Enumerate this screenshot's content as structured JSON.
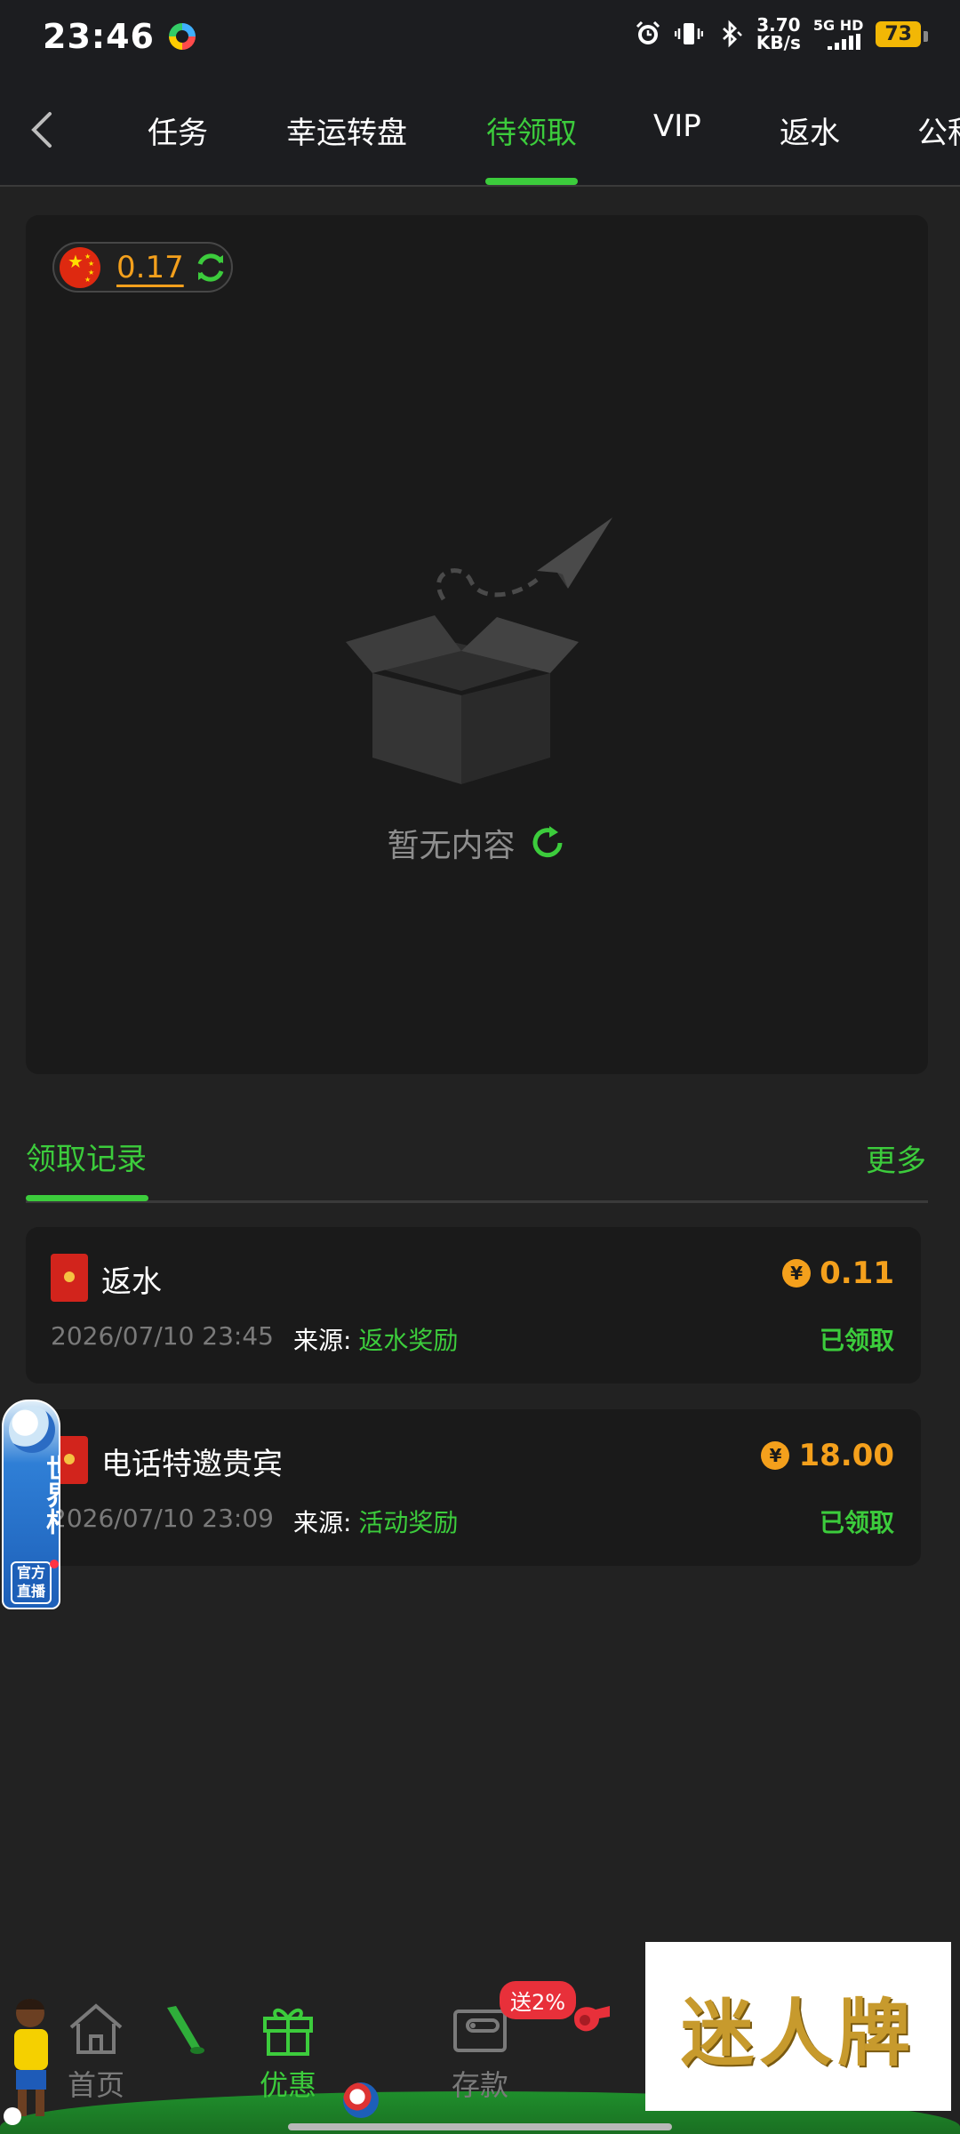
{
  "status_bar": {
    "time": "23:46",
    "net_speed_value": "3.70",
    "net_speed_unit": "KB/s",
    "net_type": "5G HD",
    "battery": "73"
  },
  "tabs": [
    {
      "label": "任务"
    },
    {
      "label": "幸运转盘"
    },
    {
      "label": "待领取"
    },
    {
      "label": "VIP"
    },
    {
      "label": "返水"
    },
    {
      "label": "公积"
    }
  ],
  "active_tab": "待领取",
  "balance": {
    "value": "0.17"
  },
  "empty_state": {
    "text": "暂无内容"
  },
  "records_section": {
    "title": "领取记录",
    "more": "更多"
  },
  "records": [
    {
      "name": "返水",
      "amount": "0.11",
      "date": "2026/07/10 23:45",
      "source_label": "来源:",
      "source_value": "返水奖励",
      "status": "已领取"
    },
    {
      "name": "电话特邀贵宾",
      "amount": "18.00",
      "date": "2026/07/10 23:09",
      "source_label": "来源:",
      "source_value": "活动奖励",
      "status": "已领取"
    }
  ],
  "world_cup_float": {
    "title": "世界杯",
    "sub": "官方直播"
  },
  "bottom_nav": {
    "items": [
      {
        "label": "首页"
      },
      {
        "label": "优惠"
      },
      {
        "label": "存款"
      }
    ],
    "promo_badge": "送2%"
  },
  "ad": {
    "text": "迷人牌"
  },
  "colors": {
    "accent_green": "#3ccc3c",
    "amount_orange": "#f4a01c",
    "background": "#222222",
    "card": "#1a1a1a"
  }
}
